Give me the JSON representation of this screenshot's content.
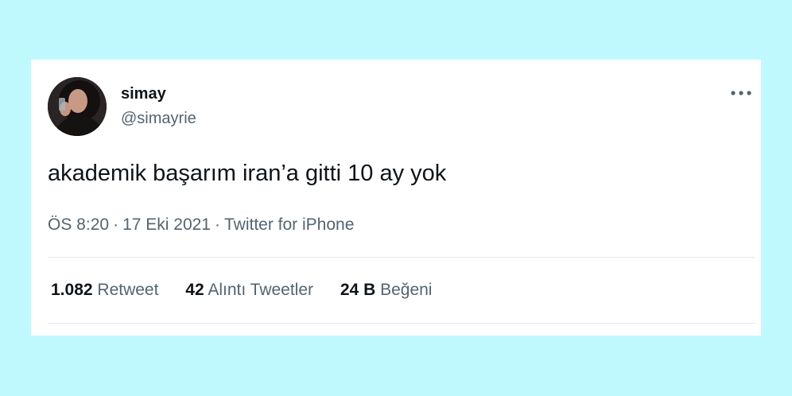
{
  "tweet": {
    "user": {
      "display_name": "simay",
      "handle": "@simayrie"
    },
    "text": "akademik başarım iran’a gitti 10 ay yok",
    "time": "ÖS 8:20",
    "date": "17 Eki 2021",
    "source": "Twitter for iPhone",
    "separator": "·",
    "stats": [
      {
        "count": "1.082",
        "label": "Retweet"
      },
      {
        "count": "42",
        "label": "Alıntı Tweetler"
      },
      {
        "count": "24 B",
        "label": "Beğeni"
      }
    ]
  },
  "colors": {
    "background": "#bff9fd",
    "card": "#ffffff",
    "primary_text": "#0f1419",
    "secondary_text": "#536471",
    "divider": "#e3e8ec"
  },
  "icons": {
    "more": "more-horizontal-icon",
    "avatar": "profile-photo"
  }
}
